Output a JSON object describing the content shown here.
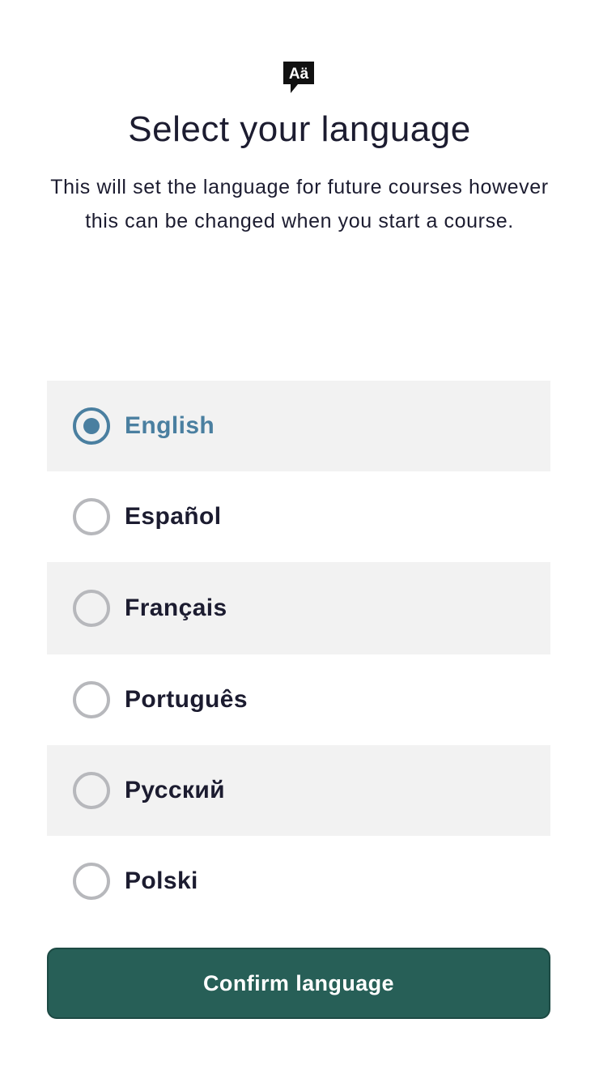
{
  "header": {
    "icon": "language-icon",
    "icon_text": "Aä",
    "title": "Select your language",
    "subtitle": "This will set the language for future courses however this can be changed when you start a course."
  },
  "languages": [
    {
      "label": "English",
      "selected": true
    },
    {
      "label": "Español",
      "selected": false
    },
    {
      "label": "Français",
      "selected": false
    },
    {
      "label": "Português",
      "selected": false
    },
    {
      "label": "Русский",
      "selected": false
    },
    {
      "label": "Polski",
      "selected": false
    }
  ],
  "confirm_label": "Confirm language",
  "colors": {
    "accent": "#4a7fa0",
    "button": "#275f57",
    "text": "#1c1c30",
    "row_shade": "#f2f2f2"
  }
}
